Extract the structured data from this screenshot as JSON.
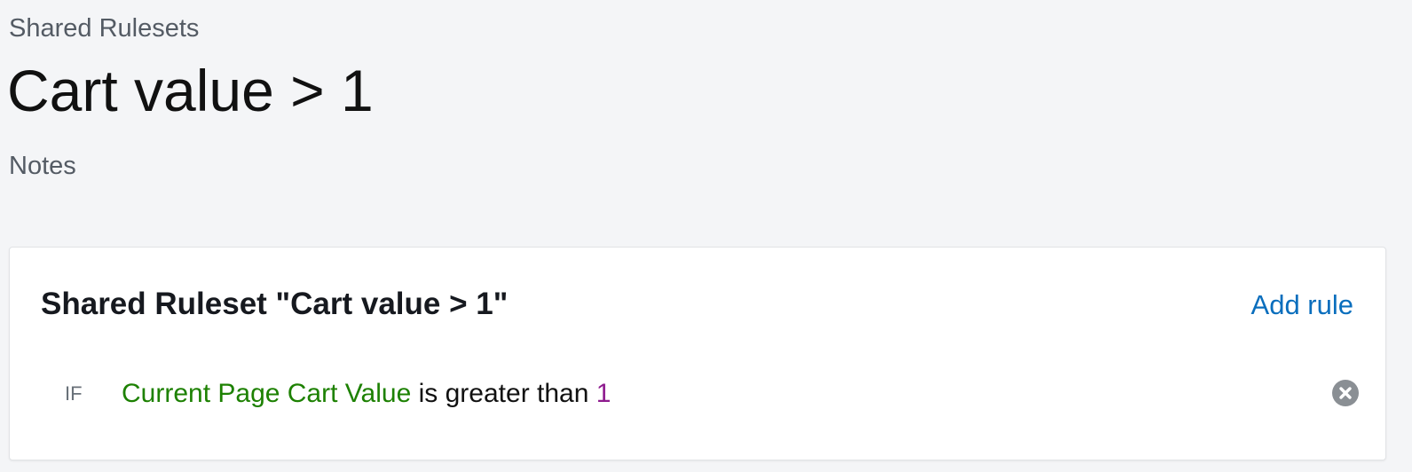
{
  "breadcrumb": "Shared Rulesets",
  "page_title": "Cart value > 1",
  "notes_label": "Notes",
  "panel": {
    "title": "Shared Ruleset \"Cart value > 1\"",
    "add_rule_label": "Add rule",
    "rules": [
      {
        "prefix": "IF",
        "attribute": "Current Page Cart Value",
        "operator": "is greater than",
        "value": "1",
        "remove_icon": "remove-circle-icon"
      }
    ]
  },
  "colors": {
    "attribute": "#1d8102",
    "value": "#8e1b8e",
    "link": "#0a6ebd",
    "background": "#f4f5f7"
  }
}
